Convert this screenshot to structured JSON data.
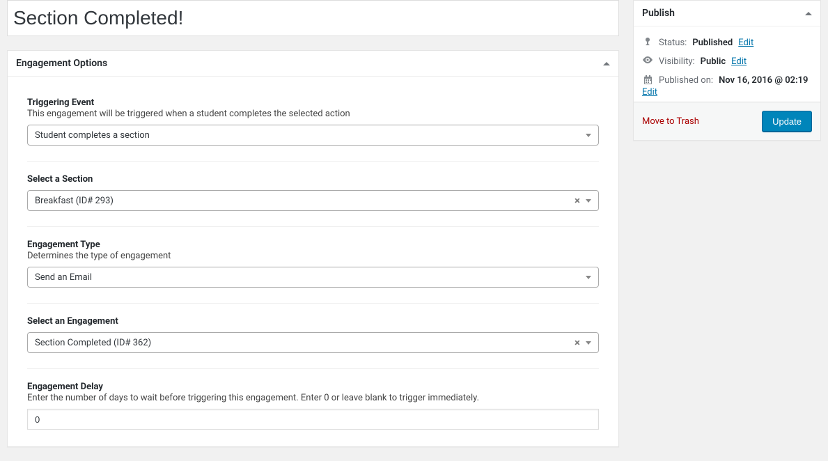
{
  "title": "Section Completed!",
  "panel": {
    "title": "Engagement Options",
    "fields": {
      "trigger": {
        "label": "Triggering Event",
        "desc": "This engagement will be triggered when a student completes the selected action",
        "value": "Student completes a section"
      },
      "section": {
        "label": "Select a Section",
        "value": "Breakfast (ID# 293)"
      },
      "type": {
        "label": "Engagement Type",
        "desc": "Determines the type of engagement",
        "value": "Send an Email"
      },
      "engagement": {
        "label": "Select an Engagement",
        "value": "Section Completed (ID# 362)"
      },
      "delay": {
        "label": "Engagement Delay",
        "desc": "Enter the number of days to wait before triggering this engagement. Enter 0 or leave blank to trigger immediately.",
        "value": "0"
      }
    }
  },
  "publish": {
    "title": "Publish",
    "status_label": "Status:",
    "status_value": "Published",
    "visibility_label": "Visibility:",
    "visibility_value": "Public",
    "published_label": "Published on:",
    "published_value": "Nov 16, 2016 @ 02:19",
    "edit": "Edit",
    "trash": "Move to Trash",
    "update": "Update"
  }
}
